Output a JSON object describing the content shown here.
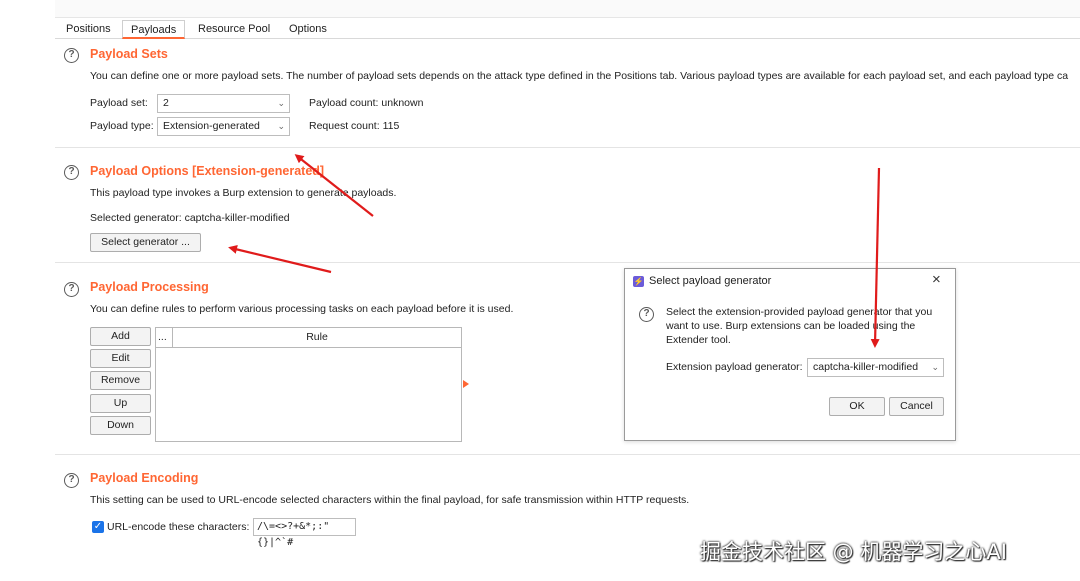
{
  "tabs": {
    "positions": "Positions",
    "payloads": "Payloads",
    "resource_pool": "Resource Pool",
    "options": "Options"
  },
  "help_glyph": "?",
  "payload_sets": {
    "title": "Payload Sets",
    "description": "You can define one or more payload sets. The number of payload sets depends on the attack type defined in the Positions tab. Various payload types are available for each payload set, and each payload type ca",
    "set_label": "Payload set:",
    "set_value": "2",
    "count_label": "Payload count:",
    "count_value": "unknown",
    "type_label": "Payload type:",
    "type_value": "Extension-generated",
    "request_label": "Request count:",
    "request_value": "115"
  },
  "payload_options": {
    "title": "Payload Options [Extension-generated]",
    "description": "This payload type invokes a Burp extension to generate payloads.",
    "selected_label": "Selected generator:",
    "selected_value": "captcha-killer-modified",
    "select_button": "Select generator ..."
  },
  "payload_processing": {
    "title": "Payload Processing",
    "description": "You can define rules to perform various processing tasks on each payload before it is used.",
    "buttons": [
      "Add",
      "Edit",
      "Remove",
      "Up",
      "Down"
    ],
    "col_ellipsis": "...",
    "col_rule": "Rule"
  },
  "payload_encoding": {
    "title": "Payload Encoding",
    "description": "This setting can be used to URL-encode selected characters within the final payload, for safe transmission within HTTP requests.",
    "checkbox_label": "URL-encode these characters:",
    "checkbox_checked": true,
    "characters": "/\\=<>?+&*;:\"{}|^`#"
  },
  "dialog": {
    "title": "Select payload generator",
    "message_line1": "Select the extension-provided payload generator that you",
    "message_line2": "want to use. Burp extensions can be loaded using the",
    "message_line3": "Extender tool.",
    "generator_label": "Extension payload generator:",
    "generator_value": "captcha-killer-modified",
    "ok": "OK",
    "cancel": "Cancel"
  },
  "watermark": "掘金技术社区 @ 机器学习之心AI",
  "colors": {
    "accent": "#ff6633",
    "annotation_arrow": "#e01b1b",
    "checkbox": "#1a73e8"
  }
}
